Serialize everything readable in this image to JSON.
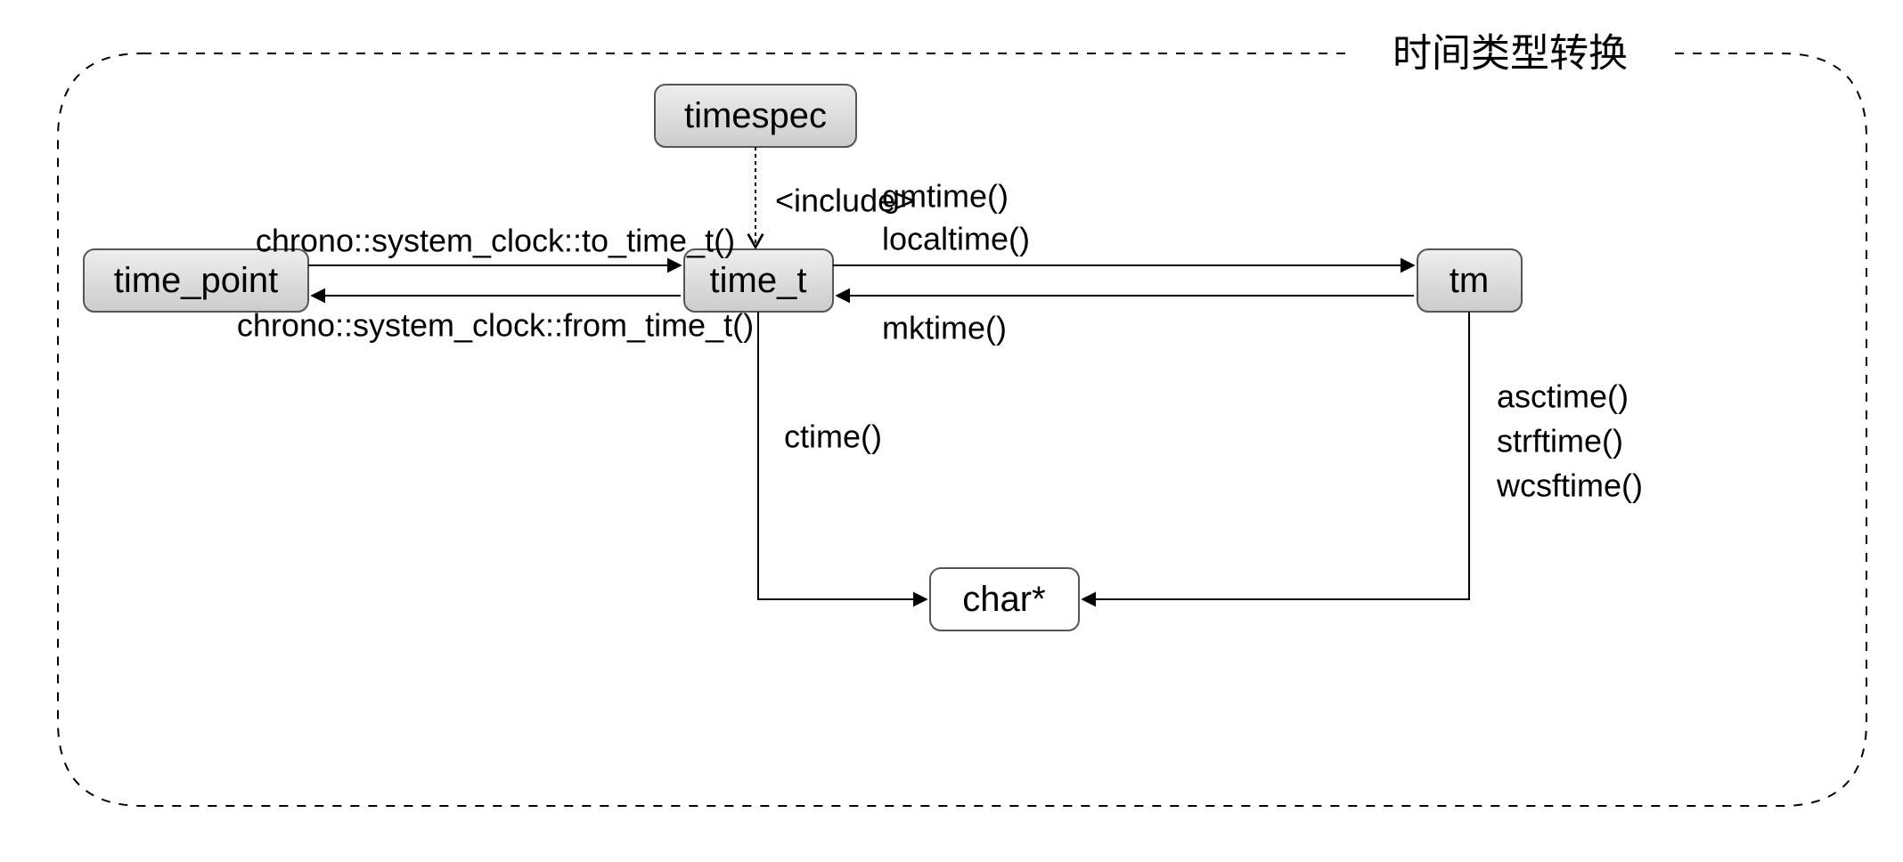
{
  "title": "时间类型转换",
  "nodes": {
    "timespec": "timespec",
    "time_point": "time_point",
    "time_t": "time_t",
    "tm": "tm",
    "char": "char*"
  },
  "edges": {
    "include": "<include>",
    "to_time_t": "chrono::system_clock::to_time_t()",
    "from_time_t": "chrono::system_clock::from_time_t()",
    "gmtime": "gmtime()",
    "localtime": "localtime()",
    "mktime": "mktime()",
    "ctime": "ctime()",
    "asctime": "asctime()",
    "strftime": "strftime()",
    "wcsftime": "wcsftime()"
  }
}
